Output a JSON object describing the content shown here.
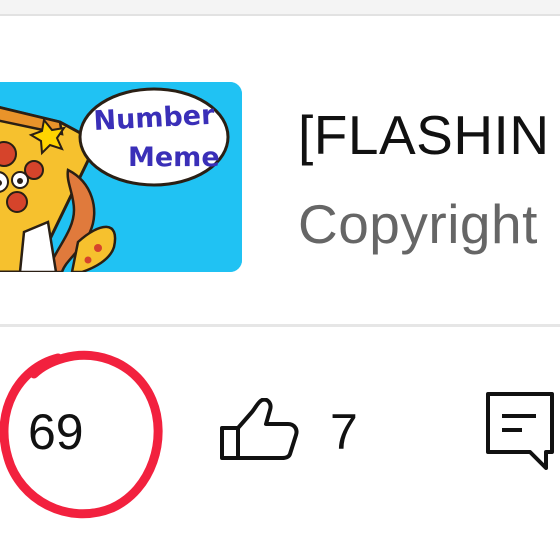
{
  "video": {
    "thumbnail_text": [
      "Number",
      "Meme"
    ],
    "title": "[FLASHIN",
    "subtitle": "Copyright"
  },
  "stats": {
    "views": "69",
    "likes": "7"
  },
  "annotation": {
    "color": "#f2213e",
    "kind": "hand-drawn circle"
  },
  "colors": {
    "thumbnail_bg": "#20c2f3",
    "title_text": "#111111",
    "subtitle_text": "#666666"
  },
  "icons": [
    "thumbs-up-icon",
    "comment-icon"
  ]
}
